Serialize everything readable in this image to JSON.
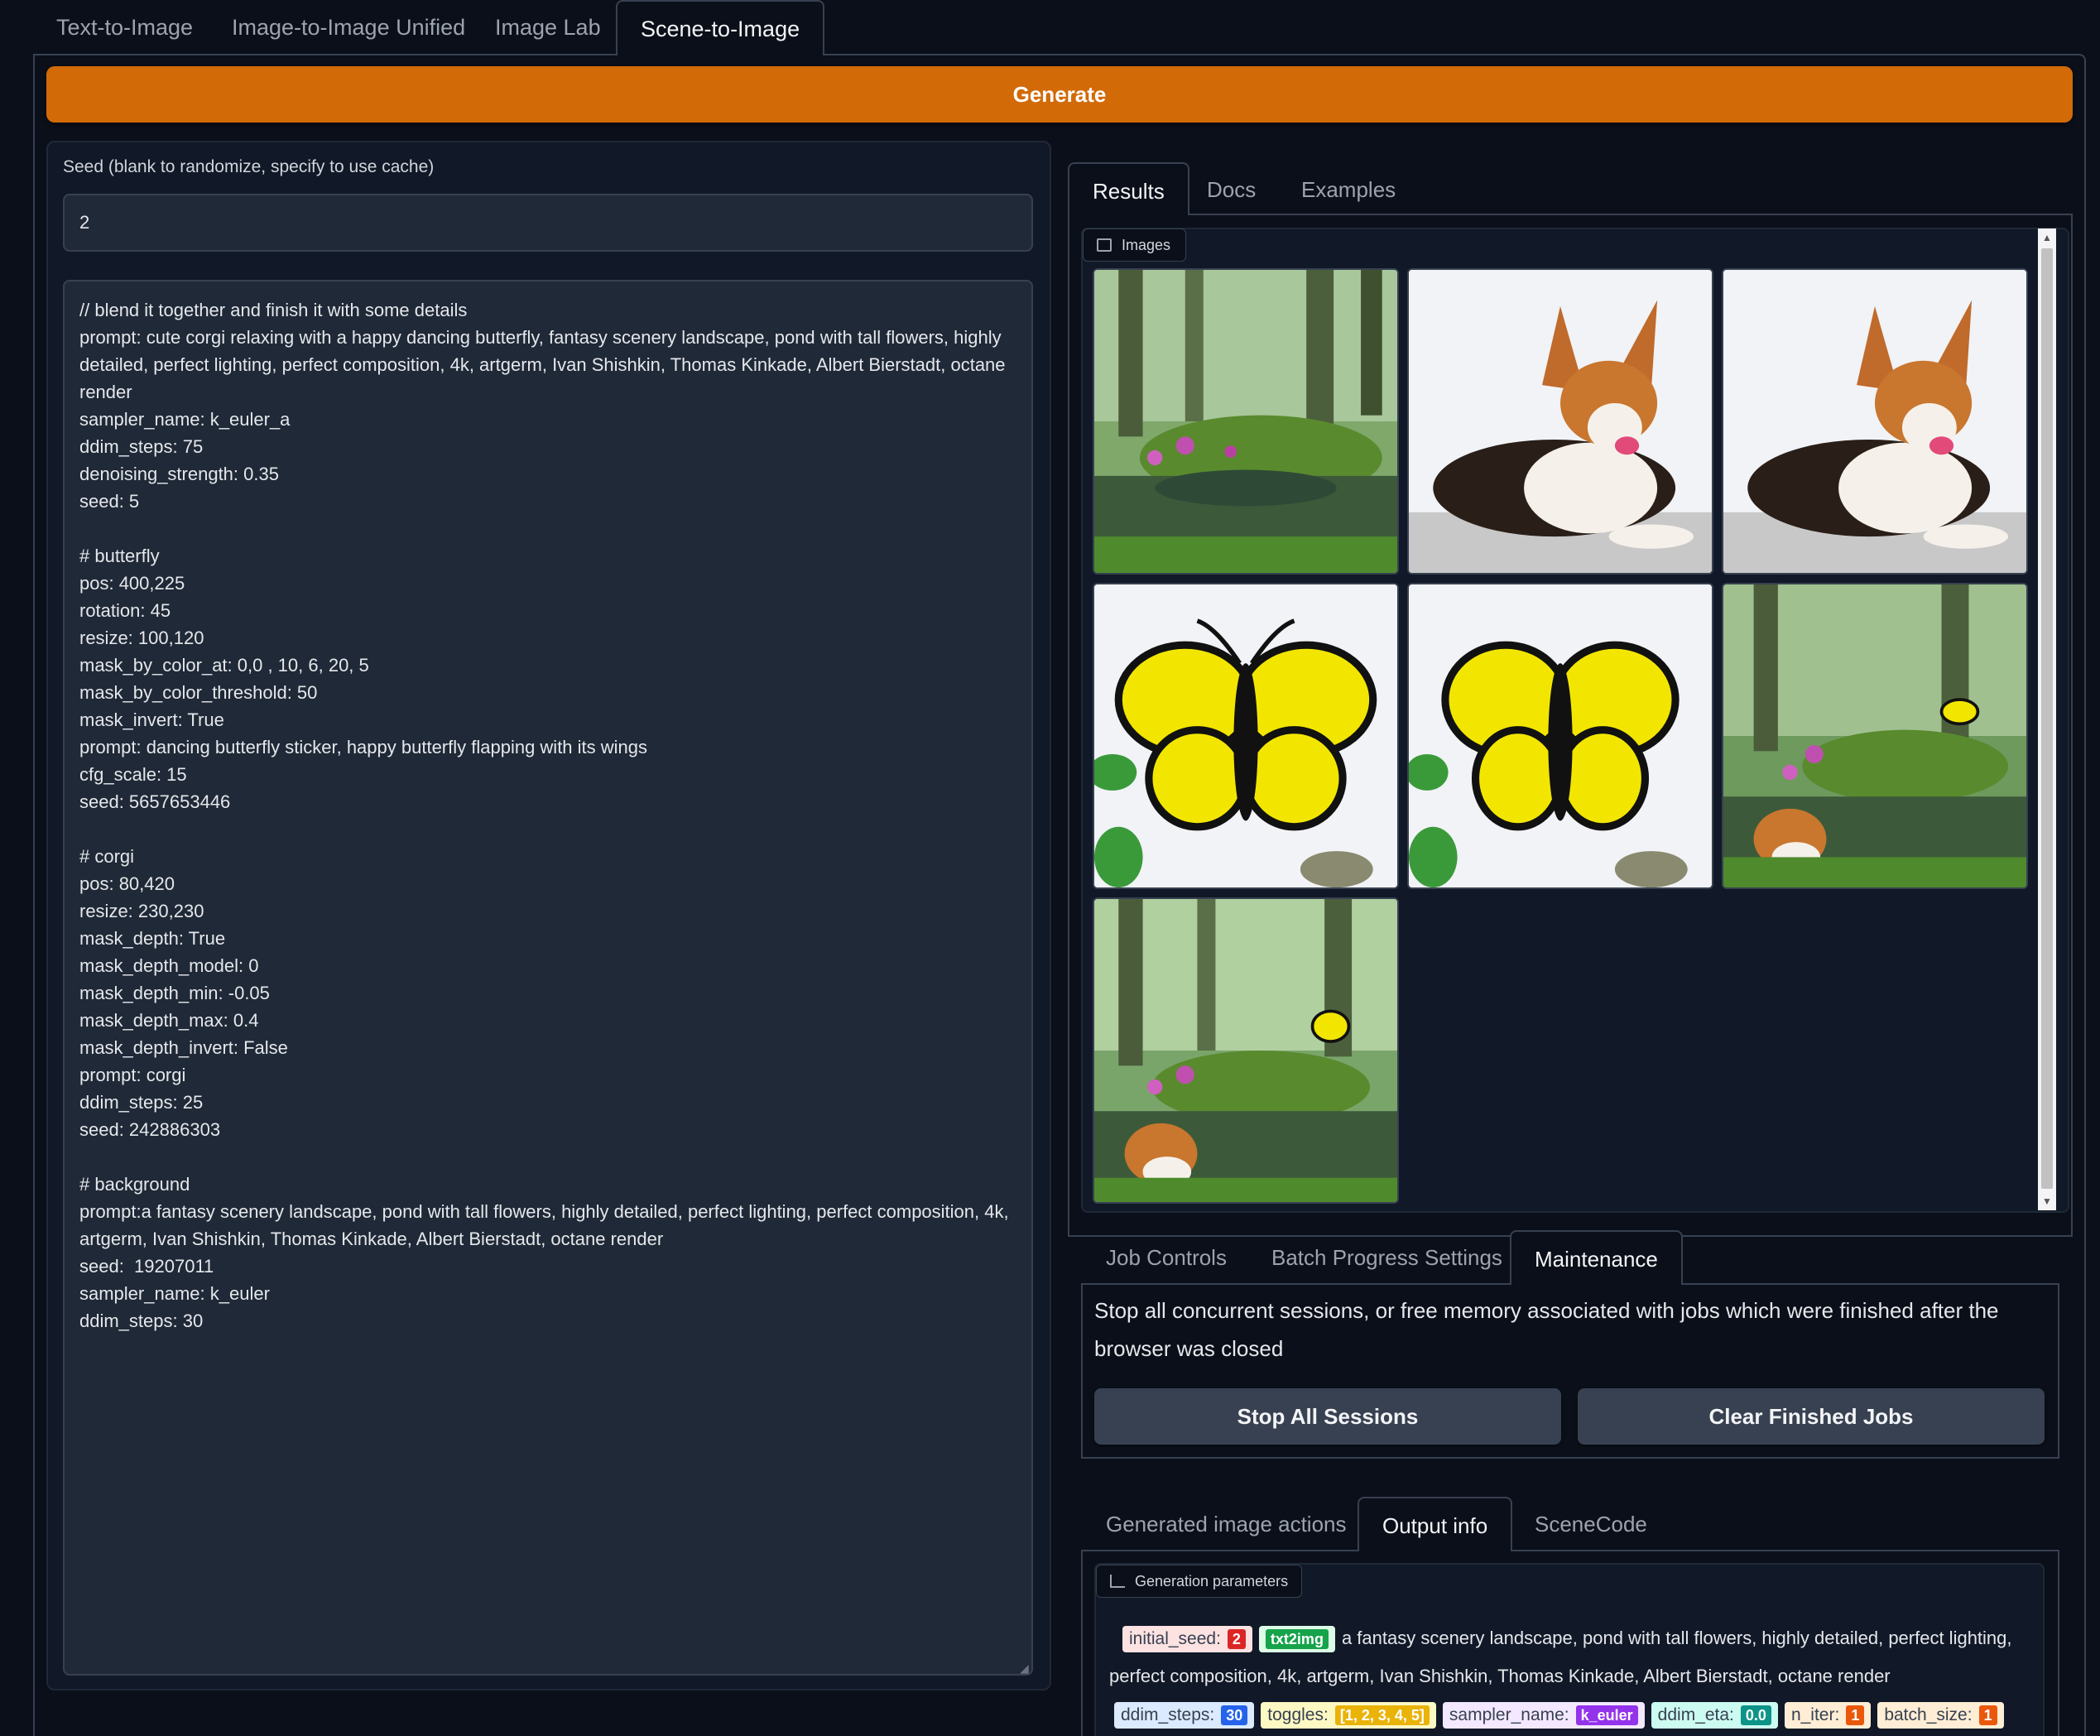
{
  "top_tabs": [
    "Text-to-Image",
    "Image-to-Image Unified",
    "Image Lab",
    "Scene-to-Image"
  ],
  "generate_label": "Generate",
  "seed": {
    "label": "Seed (blank to randomize, specify to use cache)",
    "value": "2"
  },
  "scene_script": "// blend it together and finish it with some details\nprompt: cute corgi relaxing with a happy dancing butterfly, fantasy scenery landscape, pond with tall flowers, highly detailed, perfect lighting, perfect composition, 4k, artgerm, Ivan Shishkin, Thomas Kinkade, Albert Bierstadt, octane render\nsampler_name: k_euler_a\nddim_steps: 75\ndenoising_strength: 0.35\nseed: 5\n\n# butterfly\npos: 400,225\nrotation: 45\nresize: 100,120\nmask_by_color_at: 0,0 , 10, 6, 20, 5\nmask_by_color_threshold: 50\nmask_invert: True\nprompt: dancing butterfly sticker, happy butterfly flapping with its wings\ncfg_scale: 15\nseed: 5657653446\n\n# corgi\npos: 80,420\nresize: 230,230\nmask_depth: True\nmask_depth_model: 0\nmask_depth_min: -0.05\nmask_depth_max: 0.4\nmask_depth_invert: False\nprompt: corgi\nddim_steps: 25\nseed: 242886303\n\n# background\nprompt:a fantasy scenery landscape, pond with tall flowers, highly detailed, perfect lighting, perfect composition, 4k, artgerm, Ivan Shishkin, Thomas Kinkade, Albert Bierstadt, octane render\nseed:  19207011\nsampler_name: k_euler\nddim_steps: 30",
  "result_tabs": [
    "Results",
    "Docs",
    "Examples"
  ],
  "gallery": {
    "label": "Images",
    "images": [
      "forest-pond",
      "corgi",
      "corgi",
      "butterfly",
      "butterfly",
      "composite-scene",
      "final-scene"
    ]
  },
  "job_tabs": [
    "Job Controls",
    "Batch Progress Settings",
    "Maintenance"
  ],
  "maintenance": {
    "description": "Stop all concurrent sessions, or free memory associated with jobs which were finished after the browser was closed",
    "stop_label": "Stop All Sessions",
    "clear_label": "Clear Finished Jobs"
  },
  "output_tabs": [
    "Generated image actions",
    "Output info",
    "SceneCode"
  ],
  "params": {
    "label": "Generation parameters",
    "initial_seed_key": "initial_seed:",
    "initial_seed_val": "2",
    "mode_tag": "txt2img",
    "prompt_text": "a fantasy scenery landscape, pond with tall flowers, highly detailed, perfect lighting, perfect composition, 4k, artgerm, Ivan Shishkin, Thomas Kinkade, Albert Bierstadt, octane render",
    "ddim_steps_key": "ddim_steps:",
    "ddim_steps_val": "30",
    "toggles_key": "toggles:",
    "toggles_val": "[1, 2, 3, 4, 5]",
    "sampler_key": "sampler_name:",
    "sampler_val": "k_euler",
    "ddim_eta_key": "ddim_eta:",
    "ddim_eta_val": "0.0",
    "n_iter_key": "n_iter:",
    "n_iter_val": "1",
    "batch_size_key": "batch_size:",
    "batch_size_val": "1"
  },
  "colors": {
    "accent": "#d26a08",
    "background": "#0b0f19",
    "panel": "#111827"
  }
}
